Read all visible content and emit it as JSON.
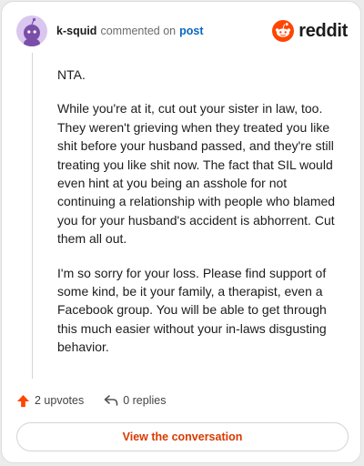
{
  "header": {
    "username": "k-squid",
    "action_text": "commented on",
    "post_link": "post",
    "logo_text": "reddit"
  },
  "comment": {
    "paragraphs": [
      "NTA.",
      "While you're at it, cut out your sister in law, too. They weren't grieving when they treated you like shit before your husband passed, and they're still treating you like shit now. The fact that SIL would even hint at you being an asshole for not continuing a relationship with people who blamed you for your husband's accident is abhorrent. Cut them all out.",
      "I'm so sorry for your loss. Please find support of some kind, be it your family, a therapist, even a Facebook group. You will be able to get through this much easier without your in-laws disgusting behavior."
    ]
  },
  "actions": {
    "upvotes": "2 upvotes",
    "replies": "0 replies"
  },
  "footer": {
    "view_button": "View the conversation"
  },
  "colors": {
    "reddit_orange": "#ff4500",
    "link_blue": "#0a66c2",
    "button_text": "#d93900",
    "avatar_bg": "#d9c7ef"
  },
  "icons": {
    "avatar": "snoo-avatar-icon",
    "logo": "reddit-snoo-icon",
    "upvote": "upvote-arrow-icon",
    "reply": "reply-arrow-icon"
  }
}
